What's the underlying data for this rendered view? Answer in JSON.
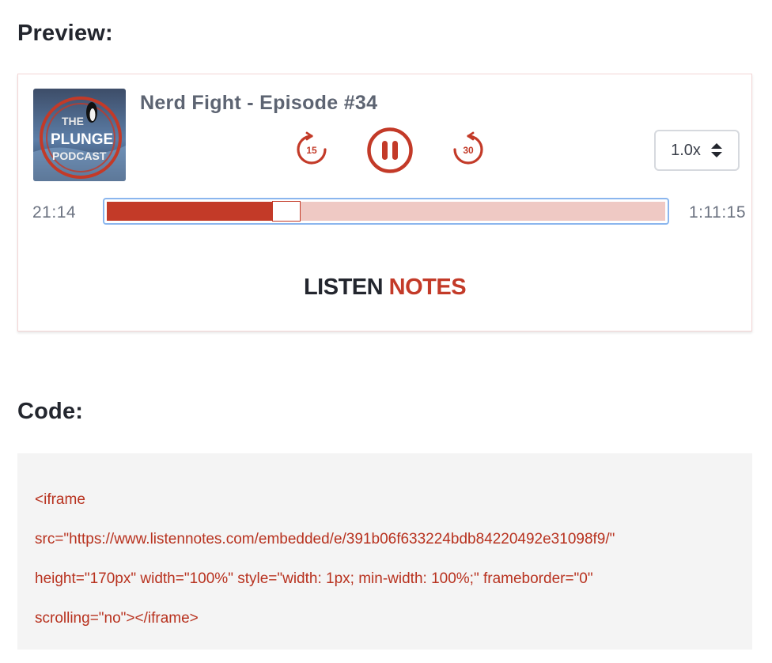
{
  "sections": {
    "preview_title": "Preview:",
    "code_title": "Code:"
  },
  "player": {
    "cover_text": [
      "THE",
      "PLUNGE",
      "PODCAST"
    ],
    "episode_title": "Nerd Fight - Episode #34",
    "rewind_label": "15",
    "forward_label": "30",
    "speed": "1.0x",
    "current_time": "21:14",
    "total_time": "1:11:15",
    "progress_fraction": 0.298,
    "brand_part1": "LISTEN",
    "brand_part2": "NOTES"
  },
  "colors": {
    "accent": "#c33a28",
    "track": "#efc9c4",
    "focus": "#8bb6ee",
    "heading": "#23262e"
  },
  "code": {
    "lines": [
      "<iframe",
      "src=\"https://www.listennotes.com/embedded/e/391b06f633224bdb84220492e31098f9/\"",
      "height=\"170px\" width=\"100%\" style=\"width: 1px; min-width: 100%;\" frameborder=\"0\"",
      "scrolling=\"no\"></iframe>"
    ]
  }
}
